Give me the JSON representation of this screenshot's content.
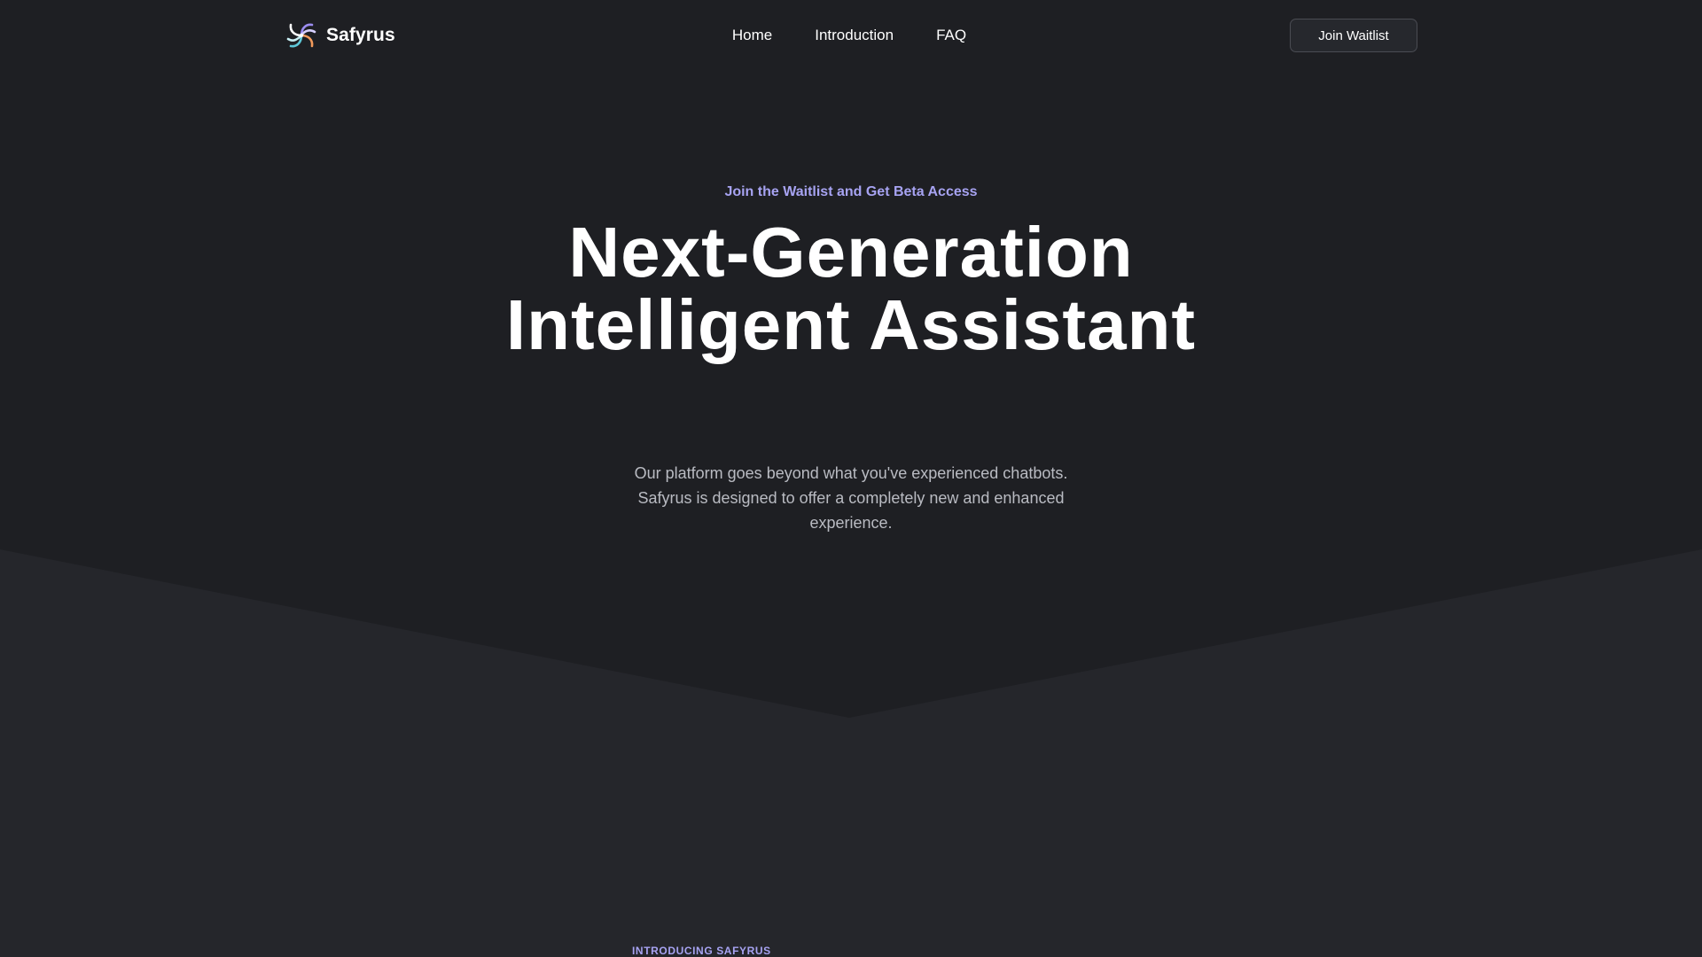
{
  "header": {
    "brand_name": "Safyrus",
    "logo_icon": "spiral-logo-icon",
    "nav": [
      {
        "label": "Home"
      },
      {
        "label": "Introduction"
      },
      {
        "label": "FAQ"
      }
    ],
    "cta_label": "Join Waitlist"
  },
  "hero": {
    "eyebrow": "Join the Waitlist and Get Beta Access",
    "headline_line1": "Next-Generation",
    "headline_line2": "Intelligent Assistant",
    "description": "Our platform goes beyond what you've experienced chatbots. Safyrus is designed to offer a completely new and enhanced experience."
  },
  "intro_section": {
    "eyebrow": "INTRODUCING SAFYRUS"
  },
  "colors": {
    "background_top": "#1e1f23",
    "background_lower": "#25262b",
    "accent": "#a7a3f2",
    "button_border": "#4a4c53"
  }
}
